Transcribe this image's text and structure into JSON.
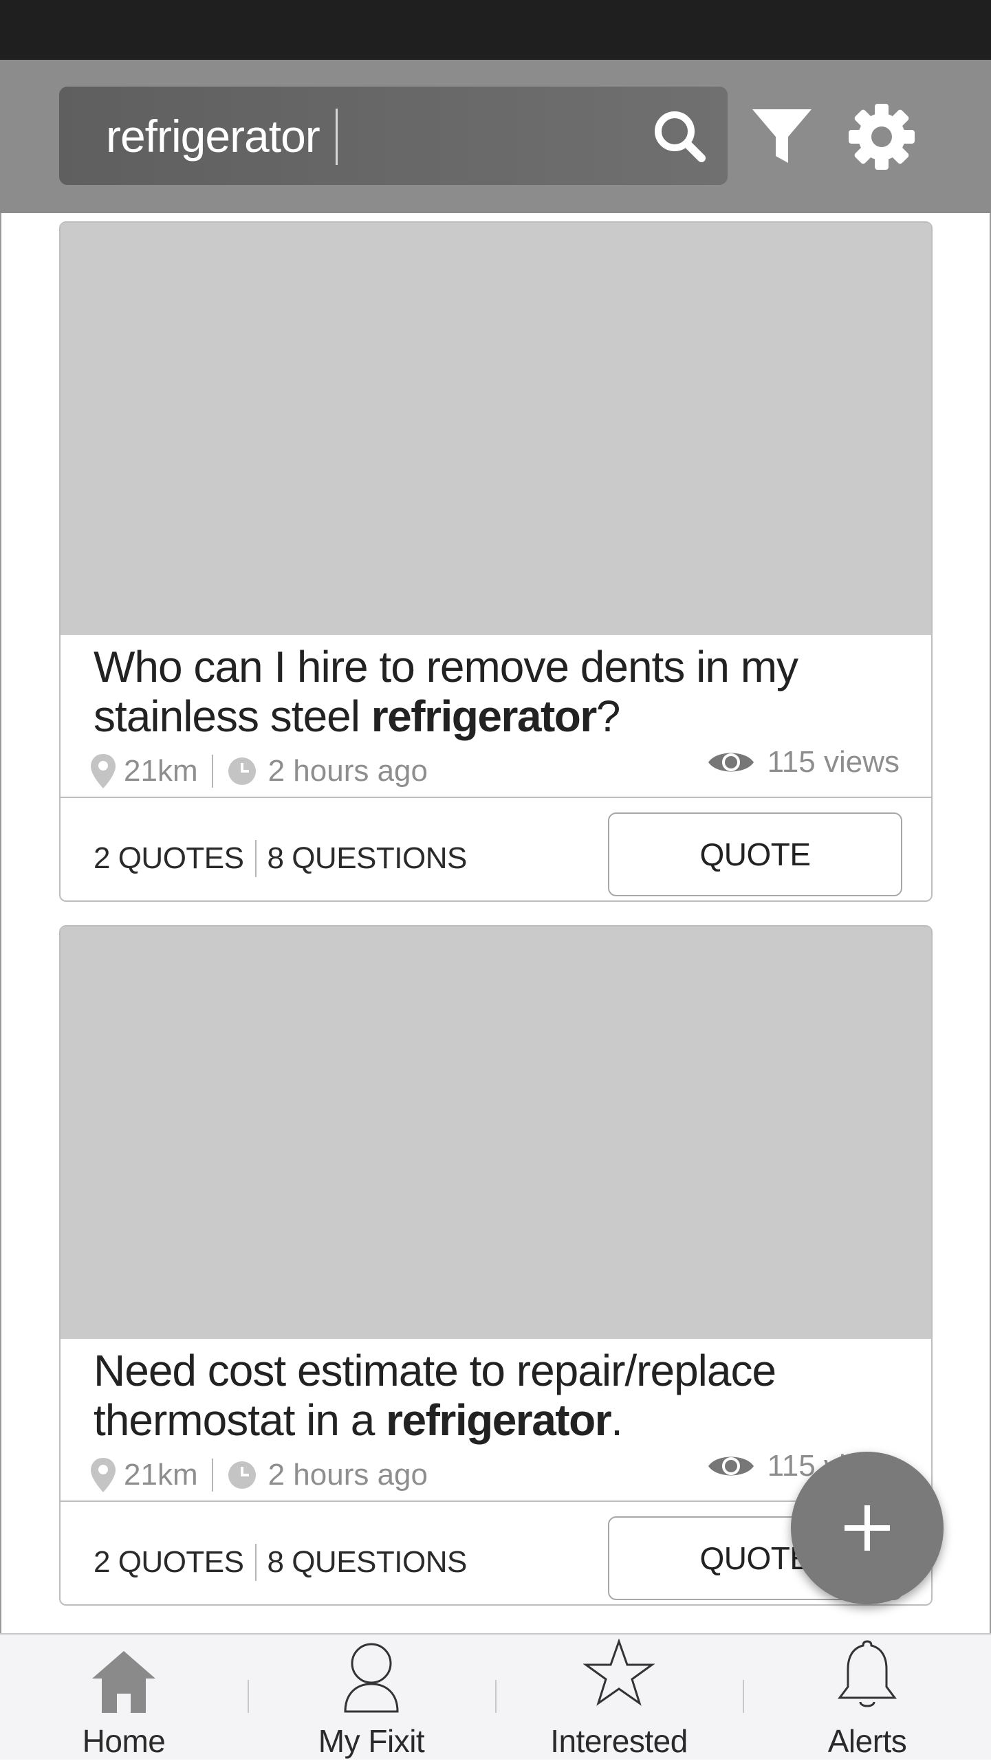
{
  "search": {
    "query": "refrigerator"
  },
  "feed": [
    {
      "title_pre": "Who can I hire to remove dents in my stainless steel ",
      "title_bold": "refrigerator",
      "title_post": "?",
      "distance": "21km",
      "time": "2 hours ago",
      "views": "115 views",
      "quotes": "2 QUOTES",
      "questions": "8 QUESTIONS",
      "quote_label": "QUOTE"
    },
    {
      "title_pre": "Need cost estimate to repair/replace thermostat in a ",
      "title_bold": "refrigerator",
      "title_post": ".",
      "distance": "21km",
      "time": "2 hours ago",
      "views": "115 views",
      "quotes": "2 QUOTES",
      "questions": "8 QUESTIONS",
      "quote_label": "QUOTE"
    }
  ],
  "fab": {
    "icon": "plus-icon"
  },
  "nav": [
    {
      "label": "Home",
      "icon": "home-icon"
    },
    {
      "label": "My Fixit",
      "icon": "person-icon"
    },
    {
      "label": "Interested",
      "icon": "star-icon"
    },
    {
      "label": "Alerts",
      "icon": "bell-icon"
    }
  ],
  "colors": {
    "top_bar": "#8c8c8c",
    "search_box": "#666666",
    "placeholder": "#cacaca",
    "fab": "#7a7a7a"
  }
}
